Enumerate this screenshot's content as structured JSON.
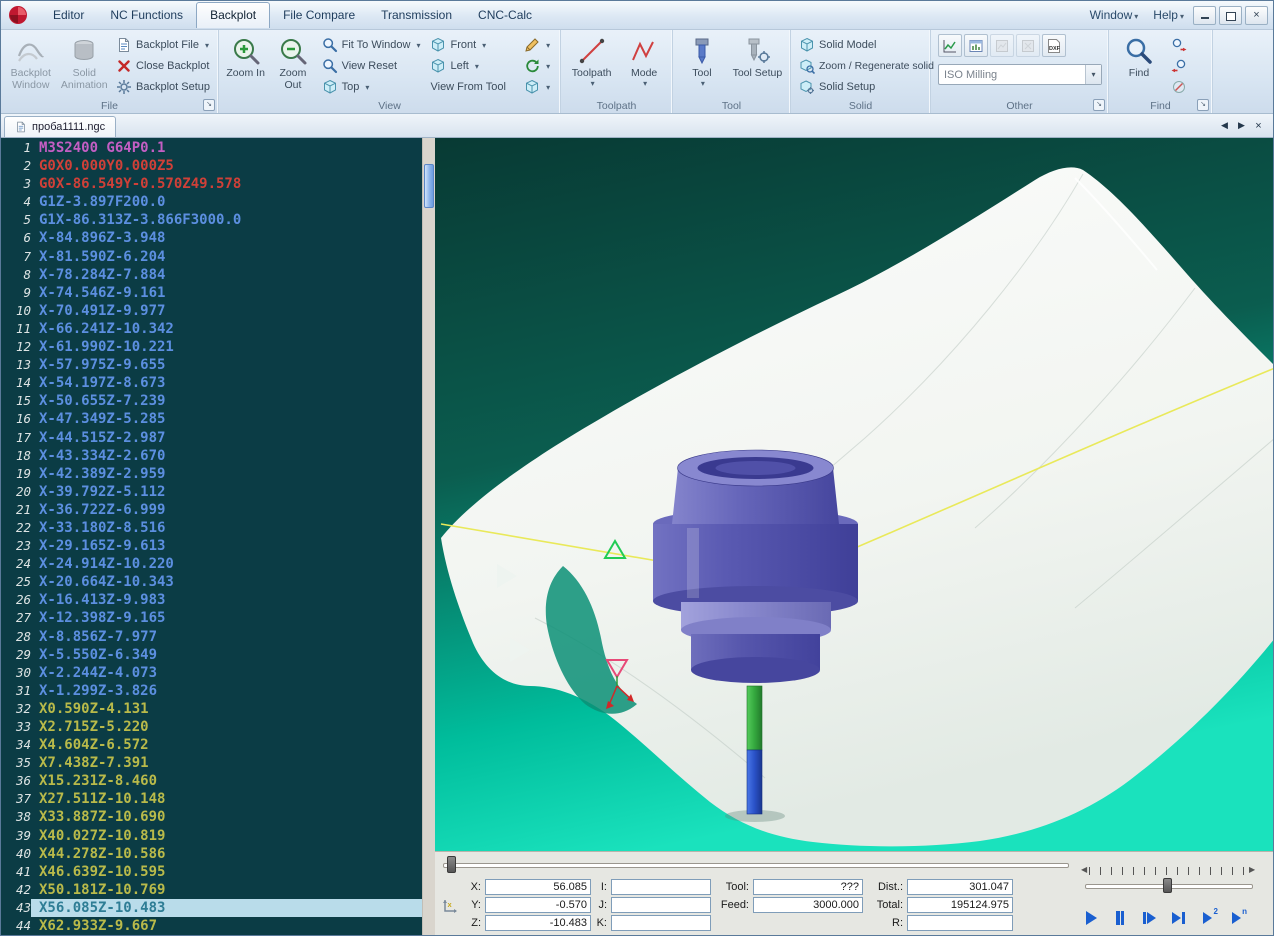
{
  "colors": {
    "accent_teal": "#00c9a4",
    "editor_bg": "#0b3c45",
    "tool_blue": "#5a5ab2",
    "toolpath_yellow": "#e9e95a",
    "selection_blue": "#b9dcea",
    "rapid_red": "#d04038",
    "feed_blue": "#5c8fe0",
    "alt_yellow": "#b9ba4a",
    "comment_magenta": "#c45ec4"
  },
  "menubar": {
    "tabs": [
      "Editor",
      "NC Functions",
      "Backplot",
      "File Compare",
      "Transmission",
      "CNC-Calc"
    ],
    "active_tab": "Backplot",
    "window_menu": "Window",
    "help_menu": "Help"
  },
  "ribbon": {
    "file": {
      "label": "File",
      "items": {
        "backplot_window": "Backplot Window",
        "solid_animation": "Solid Animation",
        "backplot_file": "Backplot File",
        "close_backplot": "Close Backplot",
        "backplot_setup": "Backplot Setup"
      }
    },
    "view": {
      "label": "View",
      "items": {
        "zoom_in": "Zoom In",
        "zoom_out": "Zoom Out",
        "fit_to_window": "Fit To Window",
        "view_reset": "View Reset",
        "top": "Top",
        "front": "Front",
        "left": "Left",
        "view_from_tool": "View From Tool"
      }
    },
    "toolpath": {
      "label": "Toolpath",
      "items": {
        "toolpath": "Toolpath",
        "mode": "Mode"
      }
    },
    "tool": {
      "label": "Tool",
      "items": {
        "tool": "Tool",
        "tool_setup": "Tool Setup"
      }
    },
    "solid": {
      "label": "Solid",
      "items": {
        "solid_model": "Solid Model",
        "zoom_regenerate": "Zoom / Regenerate solid",
        "solid_setup": "Solid Setup"
      }
    },
    "other": {
      "label": "Other",
      "machine_type": "ISO Milling",
      "dxf_label": "DXF"
    },
    "find": {
      "label": "Find",
      "items": {
        "find": "Find"
      }
    }
  },
  "filetab": {
    "name": "проба1111.ngc"
  },
  "editor": {
    "selected_line": 43,
    "lines": [
      {
        "n": 1,
        "c": "m",
        "t": "M3S2400 G64P0.1"
      },
      {
        "n": 2,
        "c": "r",
        "t": "G0X0.000Y0.000Z5"
      },
      {
        "n": 3,
        "c": "r",
        "t": "G0X-86.549Y-0.570Z49.578"
      },
      {
        "n": 4,
        "c": "b",
        "t": "G1Z-3.897F200.0"
      },
      {
        "n": 5,
        "c": "b",
        "t": "G1X-86.313Z-3.866F3000.0"
      },
      {
        "n": 6,
        "c": "b",
        "t": "X-84.896Z-3.948"
      },
      {
        "n": 7,
        "c": "b",
        "t": "X-81.590Z-6.204"
      },
      {
        "n": 8,
        "c": "b",
        "t": "X-78.284Z-7.884"
      },
      {
        "n": 9,
        "c": "b",
        "t": "X-74.546Z-9.161"
      },
      {
        "n": 10,
        "c": "b",
        "t": "X-70.491Z-9.977"
      },
      {
        "n": 11,
        "c": "b",
        "t": "X-66.241Z-10.342"
      },
      {
        "n": 12,
        "c": "b",
        "t": "X-61.990Z-10.221"
      },
      {
        "n": 13,
        "c": "b",
        "t": "X-57.975Z-9.655"
      },
      {
        "n": 14,
        "c": "b",
        "t": "X-54.197Z-8.673"
      },
      {
        "n": 15,
        "c": "b",
        "t": "X-50.655Z-7.239"
      },
      {
        "n": 16,
        "c": "b",
        "t": "X-47.349Z-5.285"
      },
      {
        "n": 17,
        "c": "b",
        "t": "X-44.515Z-2.987"
      },
      {
        "n": 18,
        "c": "b",
        "t": "X-43.334Z-2.670"
      },
      {
        "n": 19,
        "c": "b",
        "t": "X-42.389Z-2.959"
      },
      {
        "n": 20,
        "c": "b",
        "t": "X-39.792Z-5.112"
      },
      {
        "n": 21,
        "c": "b",
        "t": "X-36.722Z-6.999"
      },
      {
        "n": 22,
        "c": "b",
        "t": "X-33.180Z-8.516"
      },
      {
        "n": 23,
        "c": "b",
        "t": "X-29.165Z-9.613"
      },
      {
        "n": 24,
        "c": "b",
        "t": "X-24.914Z-10.220"
      },
      {
        "n": 25,
        "c": "b",
        "t": "X-20.664Z-10.343"
      },
      {
        "n": 26,
        "c": "b",
        "t": "X-16.413Z-9.983"
      },
      {
        "n": 27,
        "c": "b",
        "t": "X-12.398Z-9.165"
      },
      {
        "n": 28,
        "c": "b",
        "t": "X-8.856Z-7.977"
      },
      {
        "n": 29,
        "c": "b",
        "t": "X-5.550Z-6.349"
      },
      {
        "n": 30,
        "c": "b",
        "t": "X-2.244Z-4.073"
      },
      {
        "n": 31,
        "c": "b",
        "t": "X-1.299Z-3.826"
      },
      {
        "n": 32,
        "c": "y",
        "t": "X0.590Z-4.131"
      },
      {
        "n": 33,
        "c": "y",
        "t": "X2.715Z-5.220"
      },
      {
        "n": 34,
        "c": "y",
        "t": "X4.604Z-6.572"
      },
      {
        "n": 35,
        "c": "y",
        "t": "X7.438Z-7.391"
      },
      {
        "n": 36,
        "c": "y",
        "t": "X15.231Z-8.460"
      },
      {
        "n": 37,
        "c": "y",
        "t": "X27.511Z-10.148"
      },
      {
        "n": 38,
        "c": "y",
        "t": "X33.887Z-10.690"
      },
      {
        "n": 39,
        "c": "y",
        "t": "X40.027Z-10.819"
      },
      {
        "n": 40,
        "c": "y",
        "t": "X44.278Z-10.586"
      },
      {
        "n": 41,
        "c": "y",
        "t": "X46.639Z-10.595"
      },
      {
        "n": 42,
        "c": "y",
        "t": "X50.181Z-10.769"
      },
      {
        "n": 43,
        "c": "y",
        "t": "X56.085Z-10.483"
      },
      {
        "n": 44,
        "c": "y",
        "t": "X62.933Z-9.667"
      }
    ]
  },
  "statusbar": {
    "labels": {
      "x": "X:",
      "y": "Y:",
      "z": "Z:",
      "i": "I:",
      "j": "J:",
      "k": "K:",
      "tool": "Tool:",
      "feed": "Feed:",
      "dist": "Dist.:",
      "total": "Total:",
      "r": "R:"
    },
    "values": {
      "x": "56.085",
      "y": "-0.570",
      "z": "-10.483",
      "i": "",
      "j": "",
      "k": "",
      "tool": "???",
      "feed": "3000.000",
      "dist": "301.047",
      "total": "195124.975",
      "r": ""
    }
  }
}
